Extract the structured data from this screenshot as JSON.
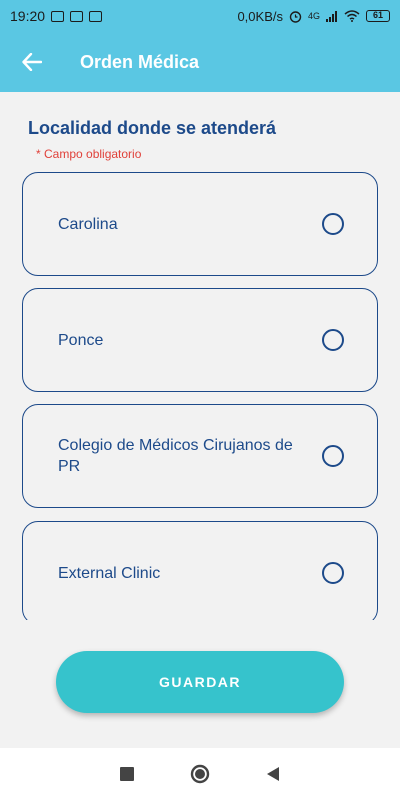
{
  "status_bar": {
    "time": "19:20",
    "speed": "0,0KB/s",
    "network": "4G",
    "battery": "61"
  },
  "app_bar": {
    "title": "Orden Médica",
    "back_icon": "arrow-left-icon",
    "color": "#5ac7e3"
  },
  "form": {
    "section_title": "Localidad donde se atenderá",
    "required_note": "* Campo obligatorio",
    "options": [
      {
        "label": "Carolina",
        "selected": false
      },
      {
        "label": "Ponce",
        "selected": false
      },
      {
        "label": "Colegio de Médicos Cirujanos de PR",
        "selected": false
      },
      {
        "label": "External Clinic",
        "selected": false
      }
    ]
  },
  "actions": {
    "save_label": "GUARDAR",
    "save_color": "#36c3cc"
  },
  "nav_bar": {
    "icons": [
      "square-icon",
      "circle-icon",
      "triangle-back-icon"
    ]
  }
}
